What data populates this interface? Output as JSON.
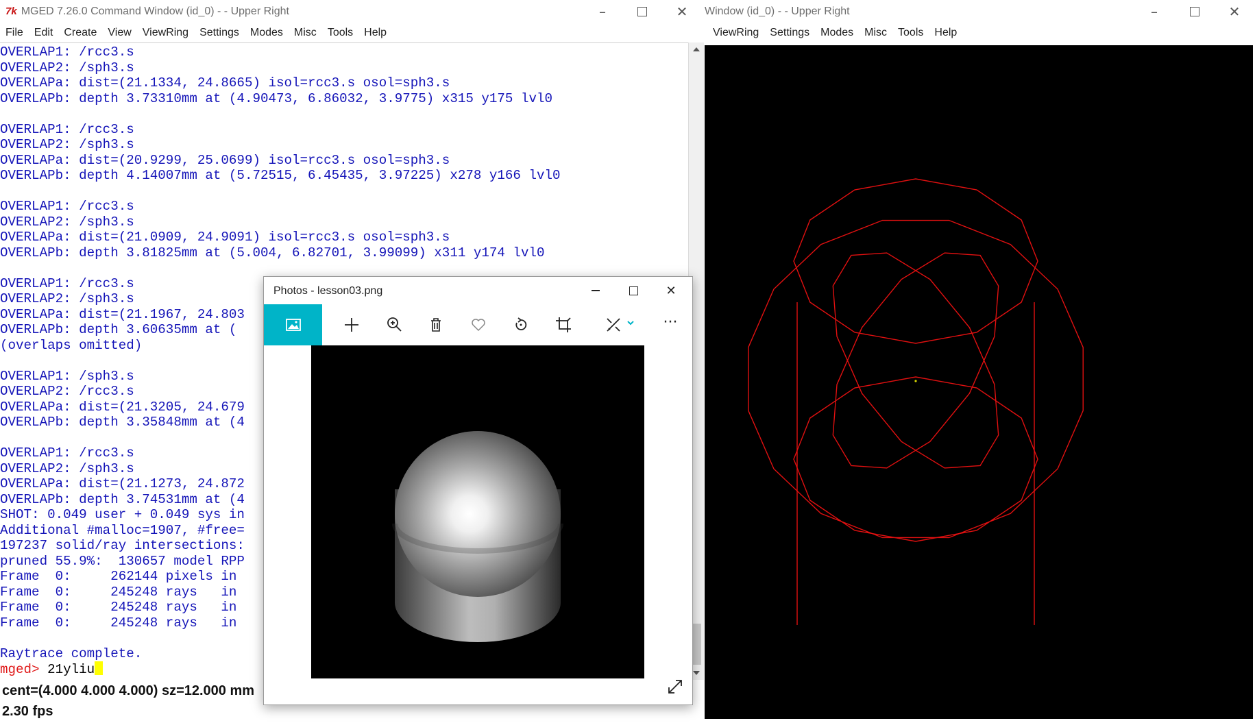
{
  "command_window": {
    "title": "MGED 7.26.0 Command Window (id_0) - - Upper Right",
    "menu": [
      "File",
      "Edit",
      "Create",
      "View",
      "ViewRing",
      "Settings",
      "Modes",
      "Misc",
      "Tools",
      "Help"
    ],
    "console_lines": [
      "OVERLAP1: /rcc3.s",
      "OVERLAP2: /sph3.s",
      "OVERLAPa: dist=(21.1334, 24.8665) isol=rcc3.s osol=sph3.s",
      "OVERLAPb: depth 3.73310mm at (4.90473, 6.86032, 3.9775) x315 y175 lvl0",
      "",
      "OVERLAP1: /rcc3.s",
      "OVERLAP2: /sph3.s",
      "OVERLAPa: dist=(20.9299, 25.0699) isol=rcc3.s osol=sph3.s",
      "OVERLAPb: depth 4.14007mm at (5.72515, 6.45435, 3.97225) x278 y166 lvl0",
      "",
      "OVERLAP1: /rcc3.s",
      "OVERLAP2: /sph3.s",
      "OVERLAPa: dist=(21.0909, 24.9091) isol=rcc3.s osol=sph3.s",
      "OVERLAPb: depth 3.81825mm at (5.004, 6.82701, 3.99099) x311 y174 lvl0",
      "",
      "OVERLAP1: /rcc3.s",
      "OVERLAP2: /sph3.s",
      "OVERLAPa: dist=(21.1967, 24.803",
      "OVERLAPb: depth 3.60635mm at (",
      "(overlaps omitted)",
      "",
      "OVERLAP1: /sph3.s",
      "OVERLAP2: /rcc3.s",
      "OVERLAPa: dist=(21.3205, 24.679",
      "OVERLAPb: depth 3.35848mm at (4",
      "",
      "OVERLAP1: /rcc3.s",
      "OVERLAP2: /sph3.s",
      "OVERLAPa: dist=(21.1273, 24.872",
      "OVERLAPb: depth 3.74531mm at (4",
      "SHOT: 0.049 user + 0.049 sys in",
      "Additional #malloc=1907, #free=",
      "197237 solid/ray intersections:",
      "pruned 55.9%:  130657 model RPP",
      "Frame  0:     262144 pixels in",
      "Frame  0:     245248 rays   in",
      "Frame  0:     245248 rays   in",
      "Frame  0:     245248 rays   in",
      "",
      "Raytrace complete."
    ],
    "prompt": "mged>",
    "input_value": "21yliu",
    "status_line1": "cent=(4.000 4.000 4.000) sz=12.000  mm",
    "status_line2": "2.30 fps"
  },
  "graphics_window": {
    "title": "Window (id_0) - - Upper Right",
    "menu": [
      "ViewRing",
      "Settings",
      "Modes",
      "Misc",
      "Tools",
      "Help"
    ],
    "wireframe_color": "#e01010",
    "center_dot_color": "#d8d800"
  },
  "photos_window": {
    "title": "Photos - lesson03.png",
    "toolbar": [
      "image-icon",
      "add-icon",
      "zoom-icon",
      "delete-icon",
      "favorite-icon",
      "rotate-icon",
      "crop-icon",
      "edit-icon",
      "more-icon"
    ],
    "more_label": "···",
    "accent_color": "#00b4c8"
  }
}
